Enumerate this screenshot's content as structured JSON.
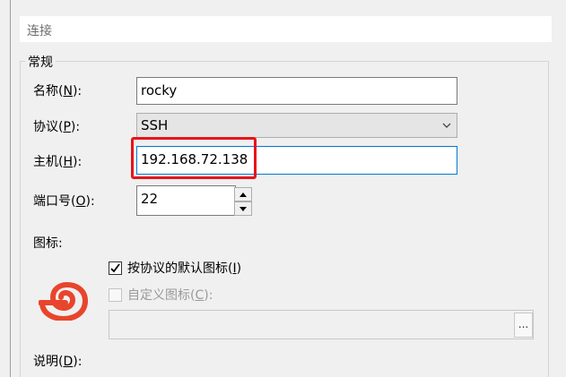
{
  "section": {
    "title": "连接"
  },
  "group": {
    "legend": "常规"
  },
  "fields": {
    "name": {
      "label_prefix": "名称(",
      "mnemonic": "N",
      "label_suffix": "):",
      "value": "rocky"
    },
    "protocol": {
      "label_prefix": "协议(",
      "mnemonic": "P",
      "label_suffix": "):",
      "value": "SSH"
    },
    "host": {
      "label_prefix": "主机(",
      "mnemonic": "H",
      "label_suffix": "):",
      "value": "192.168.72.138"
    },
    "port": {
      "label_prefix": "端口号(",
      "mnemonic": "O",
      "label_suffix": "):",
      "value": "22"
    },
    "icon": {
      "label": "图标:"
    },
    "description": {
      "label_prefix": "说明(",
      "mnemonic": "D",
      "label_suffix": "):"
    }
  },
  "icon_options": {
    "default_icon": {
      "label_prefix": "按协议的默认图标(",
      "mnemonic": "I",
      "label_suffix": ")",
      "checked": true
    },
    "custom_icon": {
      "label_prefix": "自定义图标(",
      "mnemonic": "C",
      "label_suffix": "):",
      "checked": false,
      "disabled": true
    },
    "browse_label": "..."
  },
  "icons": {
    "session_icon": "red-shell-spiral-icon",
    "dropdown": "chevron-down-icon",
    "spin_up": "spin-up-arrow-icon",
    "spin_down": "spin-down-arrow-icon"
  },
  "colors": {
    "highlight": "#e8141b",
    "session_icon": "#e8452c"
  }
}
